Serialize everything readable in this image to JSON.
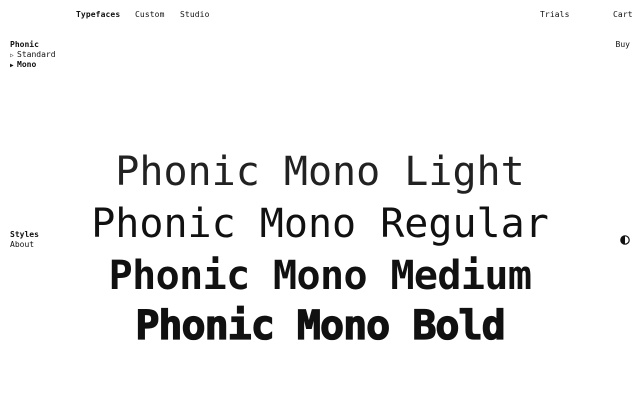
{
  "nav": {
    "typefaces": "Typefaces",
    "custom": "Custom",
    "studio": "Studio",
    "trials": "Trials",
    "cart": "Cart"
  },
  "family": {
    "name": "Phonic",
    "variants": [
      {
        "label": "Standard",
        "marker": "▷",
        "selected": false
      },
      {
        "label": "Mono",
        "marker": "▶",
        "selected": true
      }
    ]
  },
  "buy_label": "Buy",
  "sections": {
    "styles": "Styles",
    "about": "About"
  },
  "theme_toggle_icon": "half-circle-contrast-icon",
  "specimen": {
    "light": "Phonic Mono Light",
    "regular": "Phonic Mono Regular",
    "medium": "Phonic Mono Medium",
    "bold": "Phonic Mono Bold"
  }
}
